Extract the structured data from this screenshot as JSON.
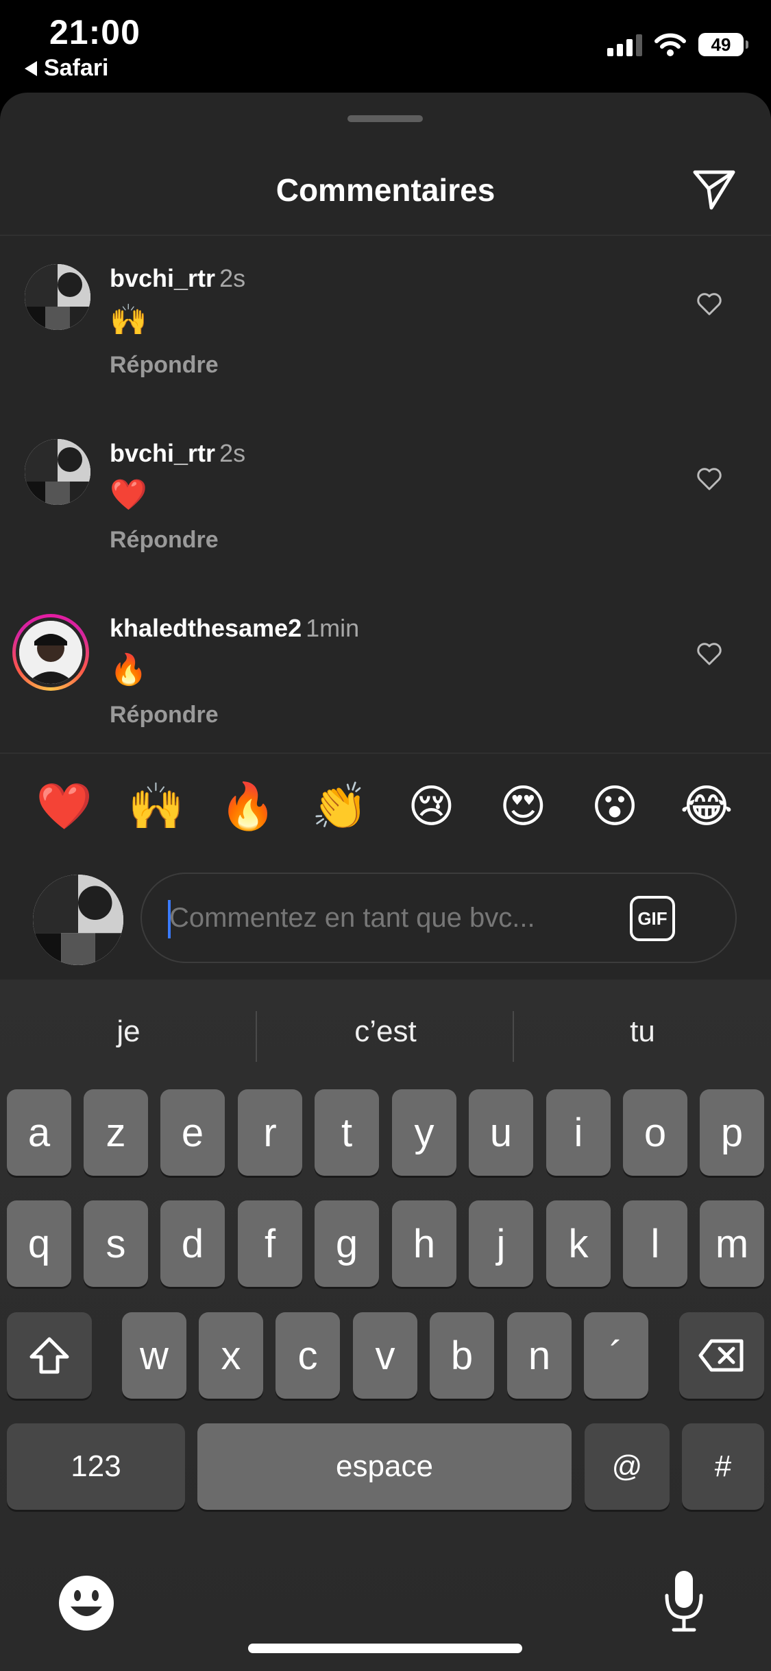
{
  "status_bar": {
    "time": "21:00",
    "back_app": "Safari",
    "battery": "49"
  },
  "sheet": {
    "title": "Commentaires"
  },
  "comments": [
    {
      "username": "bvchi_rtr",
      "timestamp": "2s",
      "text": "🙌",
      "reply": "Répondre"
    },
    {
      "username": "bvchi_rtr",
      "timestamp": "2s",
      "text": "❤️",
      "reply": "Répondre"
    },
    {
      "username": "khaledthesame2",
      "timestamp": "1min",
      "text": "🔥",
      "reply": "Répondre"
    }
  ],
  "quick_emojis": [
    "❤️",
    "🙌",
    "🔥",
    "👏",
    "😢",
    "😍",
    "😮",
    "😂"
  ],
  "comment_input": {
    "placeholder": "Commentez en tant que bvc...",
    "gif_label": "GIF"
  },
  "keyboard": {
    "suggestions": [
      "je",
      "c’est",
      "tu"
    ],
    "row1": [
      "a",
      "z",
      "e",
      "r",
      "t",
      "y",
      "u",
      "i",
      "o",
      "p"
    ],
    "row2": [
      "q",
      "s",
      "d",
      "f",
      "g",
      "h",
      "j",
      "k",
      "l",
      "m"
    ],
    "row3": [
      "w",
      "x",
      "c",
      "v",
      "b",
      "n",
      "´"
    ],
    "numbers_label": "123",
    "space_label": "espace",
    "at_label": "@",
    "hash_label": "#"
  },
  "icons": {
    "share": "paper-plane-icon",
    "like": "heart-outline-icon",
    "shift": "shift-icon",
    "delete": "backspace-icon",
    "emoji_keyboard": "emoji-icon",
    "dictation": "microphone-icon"
  }
}
